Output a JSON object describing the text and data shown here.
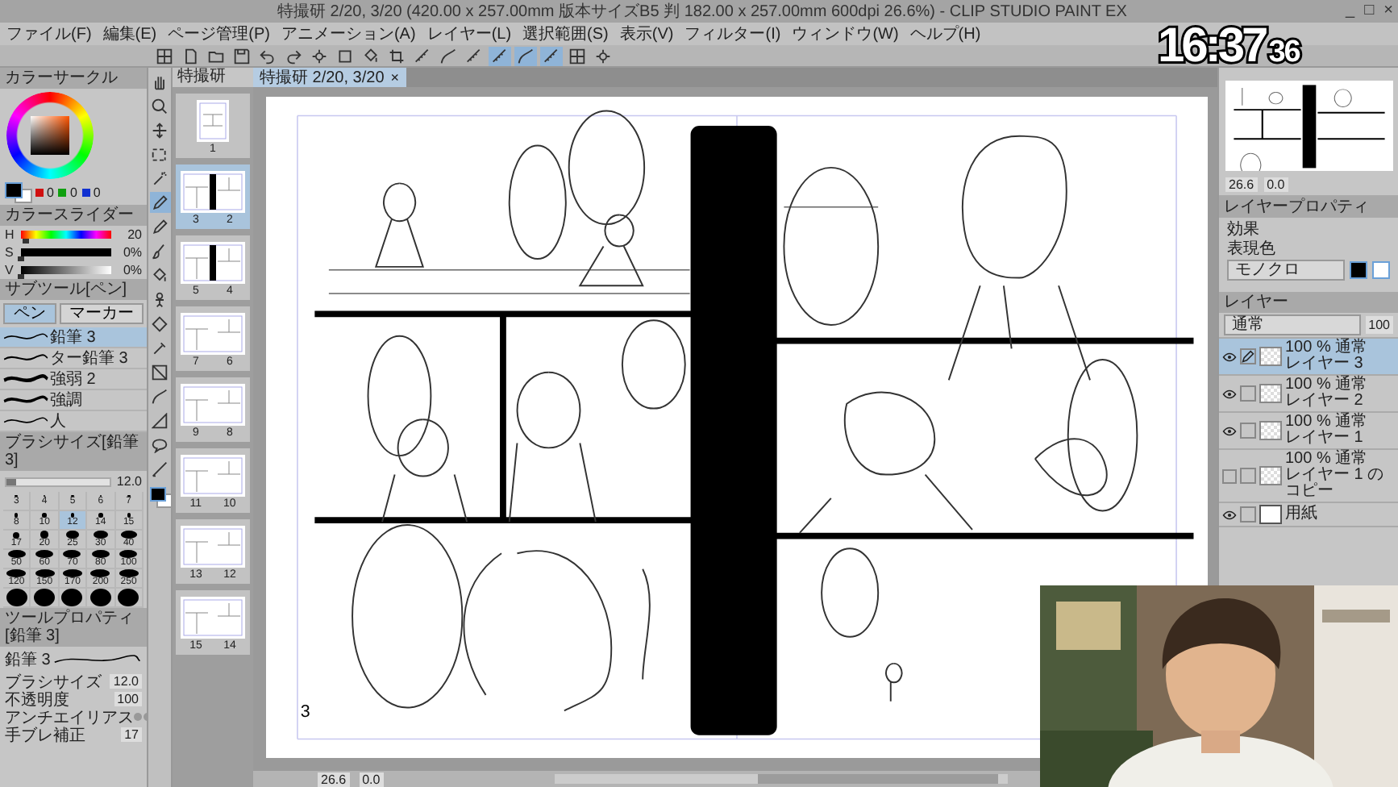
{
  "window": {
    "title": "特撮研 2/20, 3/20 (420.00 x 257.00mm 版本サイズB5 判 182.00 x 257.00mm 600dpi 26.6%) - CLIP STUDIO PAINT EX",
    "controls": [
      "_",
      "□",
      "×"
    ]
  },
  "menu": [
    "ファイル(F)",
    "編集(E)",
    "ページ管理(P)",
    "アニメーション(A)",
    "レイヤー(L)",
    "選択範囲(S)",
    "表示(V)",
    "フィルター(I)",
    "ウィンドウ(W)",
    "ヘルプ(H)"
  ],
  "toolbar": [
    {
      "selected": false
    },
    {
      "selected": false
    },
    {
      "selected": false
    },
    {
      "selected": false
    },
    {
      "selected": false
    },
    {
      "selected": false
    },
    {
      "selected": false
    },
    {
      "selected": false
    },
    {
      "selected": false
    },
    {
      "selected": false
    },
    {
      "selected": false
    },
    {
      "selected": false
    },
    {
      "selected": false
    },
    {
      "selected": true
    },
    {
      "selected": true
    },
    {
      "selected": true
    },
    {
      "selected": false
    },
    {
      "selected": false
    }
  ],
  "clock": {
    "time": "16:37",
    "seconds": "36"
  },
  "color_circle": {
    "title": "カラーサークル",
    "rgb": [
      "0",
      "0",
      "0"
    ]
  },
  "color_slider": {
    "title": "カラースライダー",
    "rows": [
      {
        "label": "H",
        "value": "20",
        "level": 0.06
      },
      {
        "label": "S",
        "value": "0%",
        "level": 0
      },
      {
        "label": "V",
        "value": "0%",
        "level": 0
      }
    ]
  },
  "sub_tool": {
    "title": "サブツール[ペン]",
    "tabs": [
      {
        "label": "ペン",
        "selected": true
      },
      {
        "label": "マーカー",
        "selected": false
      }
    ],
    "brushes": [
      {
        "name": "鉛筆 3",
        "selected": true
      },
      {
        "name": "ター鉛筆 3",
        "selected": false
      },
      {
        "name": "強弱 2",
        "selected": false
      },
      {
        "name": "強調",
        "selected": false
      },
      {
        "name": "人",
        "selected": false
      }
    ]
  },
  "brush_size": {
    "title": "ブラシサイズ[鉛筆 3]",
    "value": "12.0",
    "level": 0.1,
    "sizes": [
      {
        "kind": "labeled",
        "label": "3",
        "selected": false
      },
      {
        "kind": "labeled",
        "label": "4",
        "selected": false
      },
      {
        "kind": "labeled",
        "label": "5",
        "selected": false
      },
      {
        "kind": "labeled",
        "label": "6",
        "selected": false
      },
      {
        "kind": "labeled",
        "label": "7",
        "selected": false
      },
      {
        "kind": "labeled",
        "label": "8",
        "selected": false
      },
      {
        "kind": "labeled",
        "label": "10",
        "selected": false
      },
      {
        "kind": "labeled",
        "label": "12",
        "selected": true
      },
      {
        "kind": "labeled",
        "label": "14",
        "selected": false
      },
      {
        "kind": "labeled",
        "label": "15",
        "selected": false
      },
      {
        "kind": "labeled",
        "label": "17",
        "selected": false
      },
      {
        "kind": "labeled",
        "label": "20",
        "selected": false
      },
      {
        "kind": "labeled",
        "label": "25",
        "selected": false
      },
      {
        "kind": "labeled",
        "label": "30",
        "selected": false
      },
      {
        "kind": "labeled",
        "label": "40",
        "selected": false
      },
      {
        "kind": "labeled",
        "label": "50",
        "selected": false
      },
      {
        "kind": "labeled",
        "label": "60",
        "selected": false
      },
      {
        "kind": "labeled",
        "label": "70",
        "selected": false
      },
      {
        "kind": "labeled",
        "label": "80",
        "selected": false
      },
      {
        "kind": "labeled",
        "label": "100",
        "selected": false
      },
      {
        "kind": "labeled",
        "label": "120",
        "selected": false
      },
      {
        "kind": "labeled",
        "label": "150",
        "selected": false
      },
      {
        "kind": "labeled",
        "label": "170",
        "selected": false
      },
      {
        "kind": "labeled",
        "label": "200",
        "selected": false
      },
      {
        "kind": "labeled",
        "label": "250",
        "selected": false
      },
      {
        "kind": "dot",
        "selected": false
      },
      {
        "kind": "dot",
        "selected": false
      },
      {
        "kind": "dot",
        "selected": false
      },
      {
        "kind": "dot",
        "selected": false
      },
      {
        "kind": "dot",
        "selected": false
      }
    ]
  },
  "tool_property": {
    "title": "ツールプロパティ[鉛筆 3]",
    "brush": "鉛筆 3",
    "rows": [
      {
        "kind": "value",
        "label": "ブラシサイズ",
        "value": "12.0"
      },
      {
        "kind": "value",
        "label": "不透明度",
        "value": "100"
      },
      {
        "kind": "dots",
        "label": "アンチエイリアス"
      },
      {
        "kind": "value",
        "label": "手ブレ補正",
        "value": "17"
      }
    ]
  },
  "tools": [
    {
      "selected": false
    },
    {
      "selected": false
    },
    {
      "selected": false
    },
    {
      "selected": false
    },
    {
      "selected": false
    },
    {
      "selected": true
    },
    {
      "selected": false
    },
    {
      "selected": false
    },
    {
      "selected": false
    },
    {
      "selected": false
    },
    {
      "selected": false
    },
    {
      "selected": false
    },
    {
      "selected": false
    },
    {
      "selected": false
    },
    {
      "selected": false
    },
    {
      "selected": false
    },
    {
      "selected": false
    }
  ],
  "pages": {
    "tab": "特撮研",
    "items": [
      {
        "kind": "single",
        "labels": [
          "1"
        ],
        "selected": false
      },
      {
        "kind": "spread-bar",
        "labels": [
          "3",
          "2"
        ],
        "selected": true
      },
      {
        "kind": "spread-bar",
        "labels": [
          "5",
          "4"
        ],
        "selected": false
      },
      {
        "kind": "spread",
        "labels": [
          "7",
          "6"
        ],
        "selected": false
      },
      {
        "kind": "spread",
        "labels": [
          "9",
          "8"
        ],
        "selected": false
      },
      {
        "kind": "spread",
        "labels": [
          "11",
          "10"
        ],
        "selected": false
      },
      {
        "kind": "spread",
        "labels": [
          "13",
          "12"
        ],
        "selected": false
      },
      {
        "kind": "spread",
        "labels": [
          "15",
          "14"
        ],
        "selected": false
      }
    ]
  },
  "canvas": {
    "tab": "特撮研 2/20, 3/20",
    "close": "×",
    "page_number": "3"
  },
  "status": {
    "zoom": "26.6",
    "angle": "0.0"
  },
  "navigator": {
    "zoom": "26.6",
    "angle": "0.0"
  },
  "layer_property": {
    "title": "レイヤープロパティ",
    "effect_label": "効果",
    "color_label": "表現色",
    "color_mode": "モノクロ"
  },
  "layers": {
    "title": "レイヤー",
    "blend": "通常",
    "opacity": "100",
    "items": [
      {
        "mode": "100 % 通常",
        "name": "レイヤー 3",
        "visible": true,
        "target": true,
        "selected": true
      },
      {
        "mode": "100 % 通常",
        "name": "レイヤー 2",
        "visible": true,
        "target": false,
        "selected": false
      },
      {
        "mode": "100 % 通常",
        "name": "レイヤー 1",
        "visible": true,
        "target": false,
        "selected": false
      },
      {
        "mode": "100 % 通常",
        "name": "レイヤー 1 のコピー",
        "visible": false,
        "target": false,
        "selected": false
      },
      {
        "kind": "paper",
        "name": "用紙",
        "visible": true,
        "target": false,
        "selected": false
      }
    ]
  }
}
